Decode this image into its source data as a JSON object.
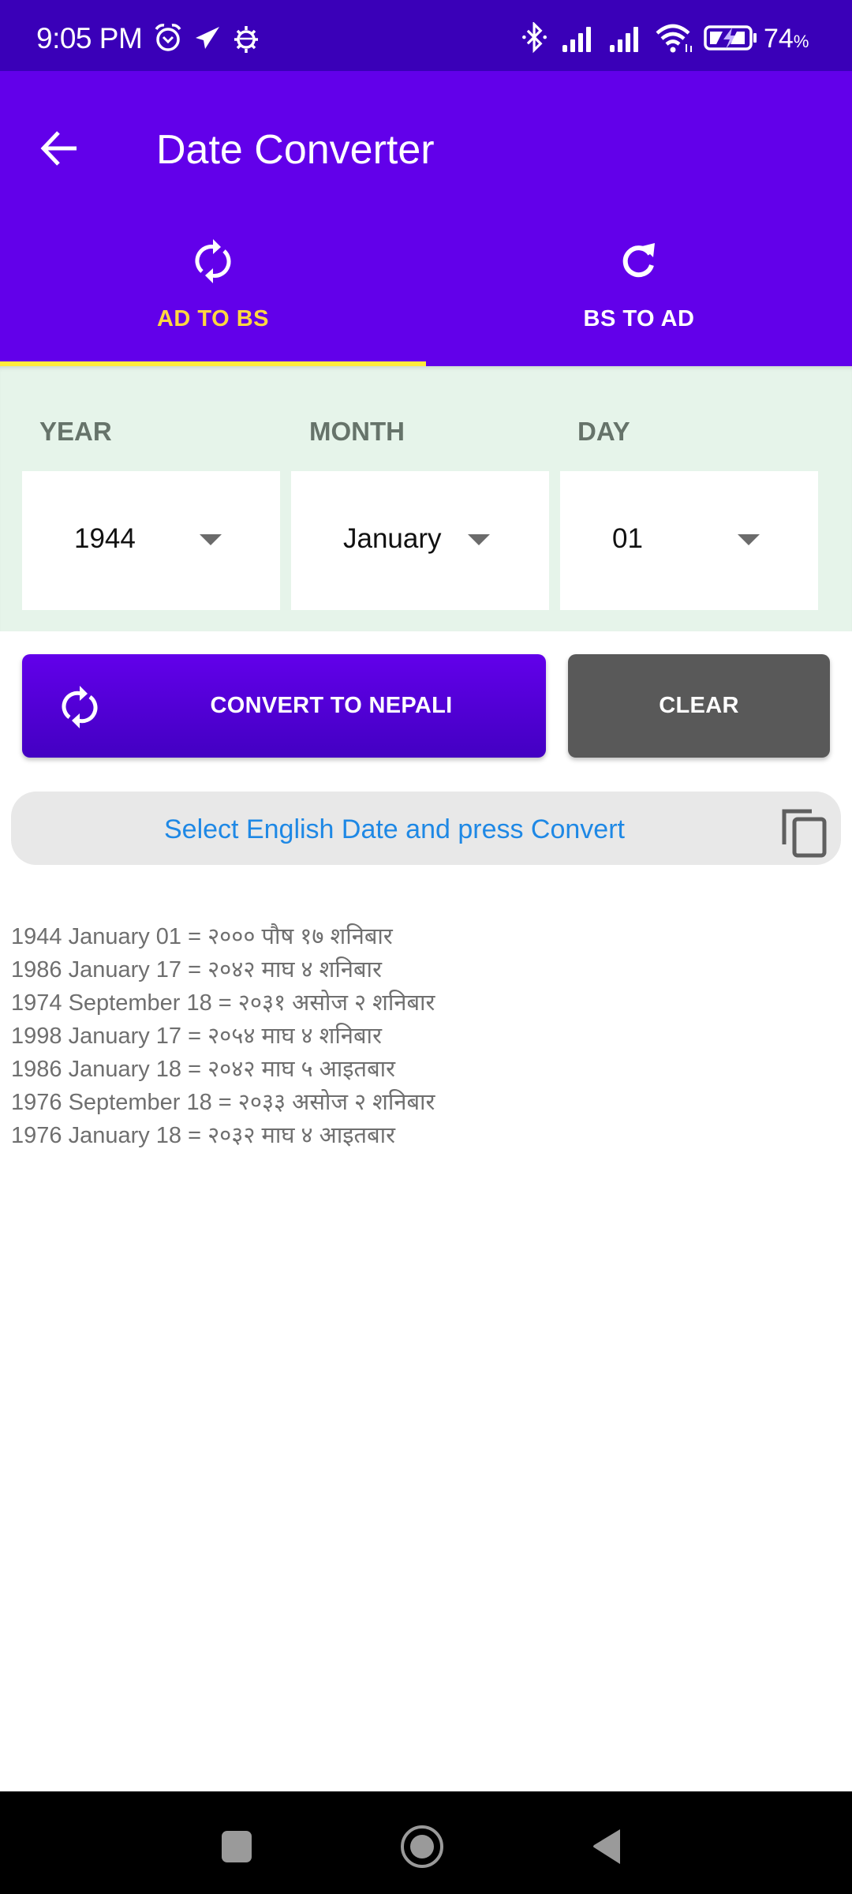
{
  "status_bar": {
    "time": "9:05 PM",
    "left_icons": [
      "alarm-icon",
      "telegram-icon",
      "android-debug-icon"
    ],
    "right_icons": [
      "bluetooth-icon",
      "signal-icon",
      "signal-icon",
      "wifi-icon",
      "battery-charging-icon"
    ],
    "battery_percent": "74",
    "battery_unit": "%"
  },
  "app_bar": {
    "title": "Date Converter",
    "back_icon": "arrow-left-icon"
  },
  "tabs": [
    {
      "label": "AD TO BS",
      "icon": "sync-icon",
      "selected": true
    },
    {
      "label": "BS TO AD",
      "icon": "refresh-icon",
      "selected": false
    }
  ],
  "picker": {
    "year": {
      "label": "YEAR",
      "value": "1944"
    },
    "month": {
      "label": "MONTH",
      "value": "January"
    },
    "day": {
      "label": "DAY",
      "value": "01"
    }
  },
  "buttons": {
    "convert": "CONVERT TO NEPALI",
    "clear": "CLEAR"
  },
  "result": {
    "text": "Select English Date and press Convert",
    "copy_icon": "copy-icon"
  },
  "history": [
    "1944 January 01 = २००० पौष १७ शनिबार",
    "1986 January 17 = २०४२ माघ ४ शनिबार",
    "1974 September 18 = २०३१ असोज २ शनिबार",
    "1998 January 17 = २०५४ माघ ४ शनिबार",
    "1986 January 18 = २०४२ माघ ५ आइतबार",
    "1976 September 18 = २०३३ असोज २ शनिबार",
    "1976 January 18 = २०३२ माघ ४ आइतबार"
  ],
  "colors": {
    "status_bar": "#3a00b8",
    "primary": "#6200ea",
    "tab_selected": "#ffd740",
    "tab_indicator": "#ffeb3b",
    "picker_background": "#e6f4ea",
    "clear_button": "#595959",
    "result_text": "#1e88e5"
  },
  "nav_bar": {
    "buttons": [
      "recents-button",
      "home-button",
      "back-button"
    ]
  }
}
